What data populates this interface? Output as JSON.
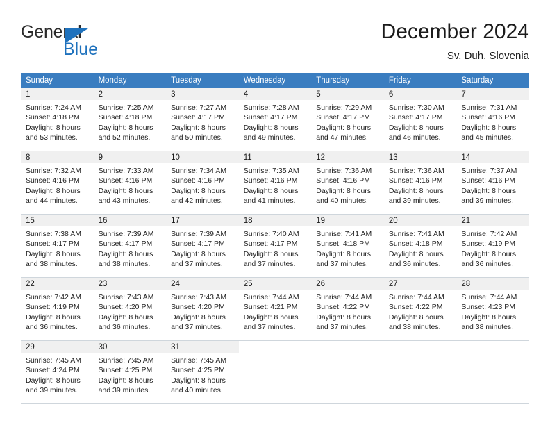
{
  "brand": {
    "name_dark": "General",
    "name_blue": "Blue",
    "accent_color": "#1f72bd"
  },
  "header": {
    "title": "December 2024",
    "location": "Sv. Duh, Slovenia"
  },
  "calendar": {
    "header_bg": "#3a7dc0",
    "daynum_bg": "#f0f0f0",
    "weekday_headers": [
      "Sunday",
      "Monday",
      "Tuesday",
      "Wednesday",
      "Thursday",
      "Friday",
      "Saturday"
    ],
    "weeks": [
      [
        {
          "day": "1",
          "sunrise": "Sunrise: 7:24 AM",
          "sunset": "Sunset: 4:18 PM",
          "daylight_line1": "Daylight: 8 hours",
          "daylight_line2": "and 53 minutes."
        },
        {
          "day": "2",
          "sunrise": "Sunrise: 7:25 AM",
          "sunset": "Sunset: 4:18 PM",
          "daylight_line1": "Daylight: 8 hours",
          "daylight_line2": "and 52 minutes."
        },
        {
          "day": "3",
          "sunrise": "Sunrise: 7:27 AM",
          "sunset": "Sunset: 4:17 PM",
          "daylight_line1": "Daylight: 8 hours",
          "daylight_line2": "and 50 minutes."
        },
        {
          "day": "4",
          "sunrise": "Sunrise: 7:28 AM",
          "sunset": "Sunset: 4:17 PM",
          "daylight_line1": "Daylight: 8 hours",
          "daylight_line2": "and 49 minutes."
        },
        {
          "day": "5",
          "sunrise": "Sunrise: 7:29 AM",
          "sunset": "Sunset: 4:17 PM",
          "daylight_line1": "Daylight: 8 hours",
          "daylight_line2": "and 47 minutes."
        },
        {
          "day": "6",
          "sunrise": "Sunrise: 7:30 AM",
          "sunset": "Sunset: 4:17 PM",
          "daylight_line1": "Daylight: 8 hours",
          "daylight_line2": "and 46 minutes."
        },
        {
          "day": "7",
          "sunrise": "Sunrise: 7:31 AM",
          "sunset": "Sunset: 4:16 PM",
          "daylight_line1": "Daylight: 8 hours",
          "daylight_line2": "and 45 minutes."
        }
      ],
      [
        {
          "day": "8",
          "sunrise": "Sunrise: 7:32 AM",
          "sunset": "Sunset: 4:16 PM",
          "daylight_line1": "Daylight: 8 hours",
          "daylight_line2": "and 44 minutes."
        },
        {
          "day": "9",
          "sunrise": "Sunrise: 7:33 AM",
          "sunset": "Sunset: 4:16 PM",
          "daylight_line1": "Daylight: 8 hours",
          "daylight_line2": "and 43 minutes."
        },
        {
          "day": "10",
          "sunrise": "Sunrise: 7:34 AM",
          "sunset": "Sunset: 4:16 PM",
          "daylight_line1": "Daylight: 8 hours",
          "daylight_line2": "and 42 minutes."
        },
        {
          "day": "11",
          "sunrise": "Sunrise: 7:35 AM",
          "sunset": "Sunset: 4:16 PM",
          "daylight_line1": "Daylight: 8 hours",
          "daylight_line2": "and 41 minutes."
        },
        {
          "day": "12",
          "sunrise": "Sunrise: 7:36 AM",
          "sunset": "Sunset: 4:16 PM",
          "daylight_line1": "Daylight: 8 hours",
          "daylight_line2": "and 40 minutes."
        },
        {
          "day": "13",
          "sunrise": "Sunrise: 7:36 AM",
          "sunset": "Sunset: 4:16 PM",
          "daylight_line1": "Daylight: 8 hours",
          "daylight_line2": "and 39 minutes."
        },
        {
          "day": "14",
          "sunrise": "Sunrise: 7:37 AM",
          "sunset": "Sunset: 4:16 PM",
          "daylight_line1": "Daylight: 8 hours",
          "daylight_line2": "and 39 minutes."
        }
      ],
      [
        {
          "day": "15",
          "sunrise": "Sunrise: 7:38 AM",
          "sunset": "Sunset: 4:17 PM",
          "daylight_line1": "Daylight: 8 hours",
          "daylight_line2": "and 38 minutes."
        },
        {
          "day": "16",
          "sunrise": "Sunrise: 7:39 AM",
          "sunset": "Sunset: 4:17 PM",
          "daylight_line1": "Daylight: 8 hours",
          "daylight_line2": "and 38 minutes."
        },
        {
          "day": "17",
          "sunrise": "Sunrise: 7:39 AM",
          "sunset": "Sunset: 4:17 PM",
          "daylight_line1": "Daylight: 8 hours",
          "daylight_line2": "and 37 minutes."
        },
        {
          "day": "18",
          "sunrise": "Sunrise: 7:40 AM",
          "sunset": "Sunset: 4:17 PM",
          "daylight_line1": "Daylight: 8 hours",
          "daylight_line2": "and 37 minutes."
        },
        {
          "day": "19",
          "sunrise": "Sunrise: 7:41 AM",
          "sunset": "Sunset: 4:18 PM",
          "daylight_line1": "Daylight: 8 hours",
          "daylight_line2": "and 37 minutes."
        },
        {
          "day": "20",
          "sunrise": "Sunrise: 7:41 AM",
          "sunset": "Sunset: 4:18 PM",
          "daylight_line1": "Daylight: 8 hours",
          "daylight_line2": "and 36 minutes."
        },
        {
          "day": "21",
          "sunrise": "Sunrise: 7:42 AM",
          "sunset": "Sunset: 4:19 PM",
          "daylight_line1": "Daylight: 8 hours",
          "daylight_line2": "and 36 minutes."
        }
      ],
      [
        {
          "day": "22",
          "sunrise": "Sunrise: 7:42 AM",
          "sunset": "Sunset: 4:19 PM",
          "daylight_line1": "Daylight: 8 hours",
          "daylight_line2": "and 36 minutes."
        },
        {
          "day": "23",
          "sunrise": "Sunrise: 7:43 AM",
          "sunset": "Sunset: 4:20 PM",
          "daylight_line1": "Daylight: 8 hours",
          "daylight_line2": "and 36 minutes."
        },
        {
          "day": "24",
          "sunrise": "Sunrise: 7:43 AM",
          "sunset": "Sunset: 4:20 PM",
          "daylight_line1": "Daylight: 8 hours",
          "daylight_line2": "and 37 minutes."
        },
        {
          "day": "25",
          "sunrise": "Sunrise: 7:44 AM",
          "sunset": "Sunset: 4:21 PM",
          "daylight_line1": "Daylight: 8 hours",
          "daylight_line2": "and 37 minutes."
        },
        {
          "day": "26",
          "sunrise": "Sunrise: 7:44 AM",
          "sunset": "Sunset: 4:22 PM",
          "daylight_line1": "Daylight: 8 hours",
          "daylight_line2": "and 37 minutes."
        },
        {
          "day": "27",
          "sunrise": "Sunrise: 7:44 AM",
          "sunset": "Sunset: 4:22 PM",
          "daylight_line1": "Daylight: 8 hours",
          "daylight_line2": "and 38 minutes."
        },
        {
          "day": "28",
          "sunrise": "Sunrise: 7:44 AM",
          "sunset": "Sunset: 4:23 PM",
          "daylight_line1": "Daylight: 8 hours",
          "daylight_line2": "and 38 minutes."
        }
      ],
      [
        {
          "day": "29",
          "sunrise": "Sunrise: 7:45 AM",
          "sunset": "Sunset: 4:24 PM",
          "daylight_line1": "Daylight: 8 hours",
          "daylight_line2": "and 39 minutes."
        },
        {
          "day": "30",
          "sunrise": "Sunrise: 7:45 AM",
          "sunset": "Sunset: 4:25 PM",
          "daylight_line1": "Daylight: 8 hours",
          "daylight_line2": "and 39 minutes."
        },
        {
          "day": "31",
          "sunrise": "Sunrise: 7:45 AM",
          "sunset": "Sunset: 4:25 PM",
          "daylight_line1": "Daylight: 8 hours",
          "daylight_line2": "and 40 minutes."
        },
        {
          "day": "",
          "sunrise": "",
          "sunset": "",
          "daylight_line1": "",
          "daylight_line2": ""
        },
        {
          "day": "",
          "sunrise": "",
          "sunset": "",
          "daylight_line1": "",
          "daylight_line2": ""
        },
        {
          "day": "",
          "sunrise": "",
          "sunset": "",
          "daylight_line1": "",
          "daylight_line2": ""
        },
        {
          "day": "",
          "sunrise": "",
          "sunset": "",
          "daylight_line1": "",
          "daylight_line2": ""
        }
      ]
    ]
  }
}
